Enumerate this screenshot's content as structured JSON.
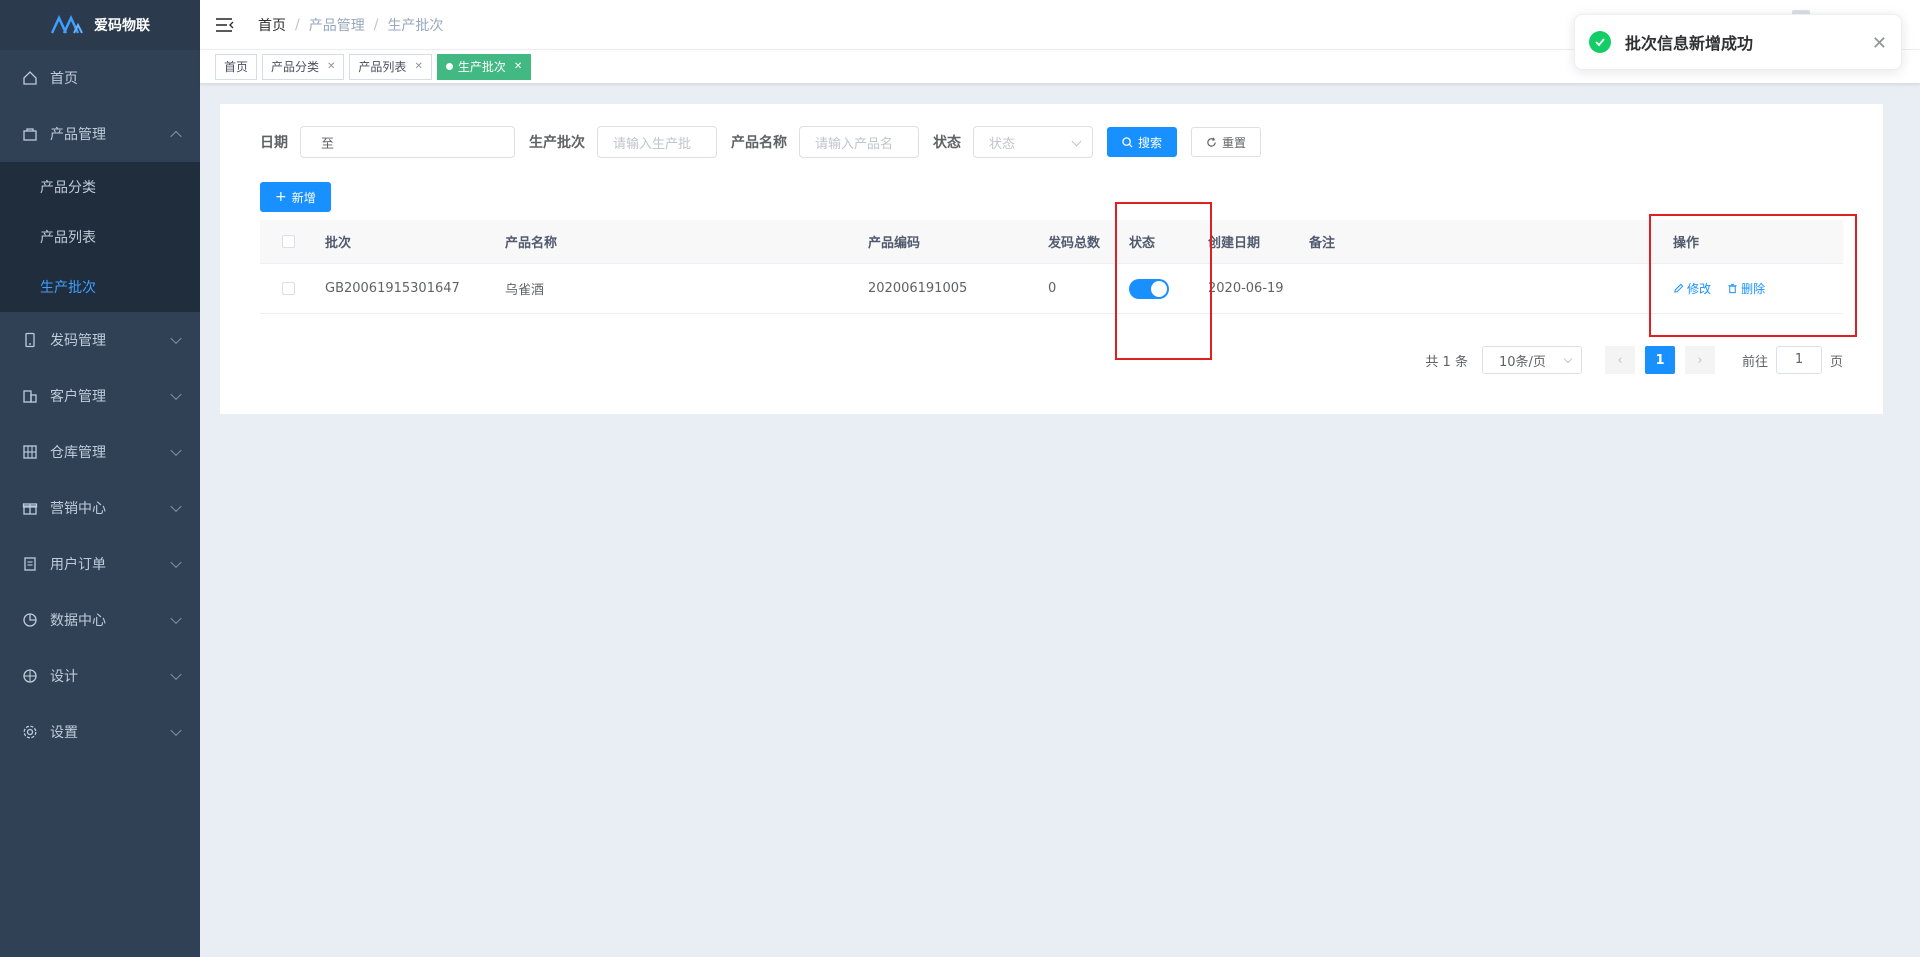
{
  "app": {
    "title": "爱码物联"
  },
  "sidebar": {
    "items": [
      {
        "label": "首页",
        "icon": "home-icon"
      },
      {
        "label": "产品管理",
        "icon": "shopping-bag-icon",
        "expanded": true,
        "children": [
          {
            "label": "产品分类"
          },
          {
            "label": "产品列表"
          },
          {
            "label": "生产批次",
            "active": true
          }
        ]
      },
      {
        "label": "发码管理",
        "icon": "mobile-icon"
      },
      {
        "label": "客户管理",
        "icon": "office-building-icon"
      },
      {
        "label": "仓库管理",
        "icon": "warehouse-icon"
      },
      {
        "label": "营销中心",
        "icon": "gift-icon"
      },
      {
        "label": "用户订单",
        "icon": "document-icon"
      },
      {
        "label": "数据中心",
        "icon": "pie-chart-icon"
      },
      {
        "label": "设计",
        "icon": "basketball-icon"
      },
      {
        "label": "设置",
        "icon": "gear-icon"
      }
    ]
  },
  "header": {
    "breadcrumb": [
      "首页",
      "产品管理",
      "生产批次"
    ]
  },
  "tags": [
    {
      "label": "首页",
      "closable": false
    },
    {
      "label": "产品分类",
      "closable": true
    },
    {
      "label": "产品列表",
      "closable": true
    },
    {
      "label": "生产批次",
      "closable": true,
      "active": true
    }
  ],
  "filter": {
    "date_label": "日期",
    "date_value": "至",
    "batch_label": "生产批次",
    "batch_placeholder": "请输入生产批",
    "name_label": "产品名称",
    "name_placeholder": "请输入产品名",
    "status_label": "状态",
    "status_placeholder": "状态",
    "search_label": "搜索",
    "reset_label": "重置"
  },
  "add_label": "新增",
  "table": {
    "columns": [
      "批次",
      "产品名称",
      "产品编码",
      "发码总数",
      "状态",
      "创建日期",
      "备注",
      "操作"
    ],
    "rows": [
      {
        "batch": "GB20061915301647",
        "name": "乌雀酒",
        "code": "202006191005",
        "total": "0",
        "status_on": true,
        "created": "2020-06-19",
        "remark": "",
        "edit_label": "修改",
        "delete_label": "删除"
      }
    ]
  },
  "pagination": {
    "total_text": "共 1 条",
    "page_size": "10条/页",
    "current_page": "1",
    "goto_prefix": "前往",
    "goto_value": "1",
    "goto_suffix": "页"
  },
  "toast": {
    "type": "success",
    "message": "批次信息新增成功"
  },
  "colors": {
    "sidebar_bg": "#304156",
    "accent": "#1890ff",
    "active_tag": "#42b983",
    "success": "#13ce66",
    "highlight": "#e02020"
  }
}
